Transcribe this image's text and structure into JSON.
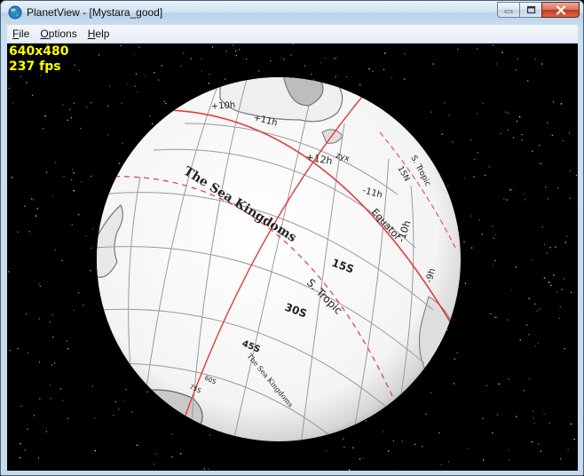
{
  "window": {
    "title": "PlanetView - [Mystara_good]",
    "app_icon": "globe-icon"
  },
  "menu": {
    "items": [
      {
        "label": "File",
        "accesskey": "F"
      },
      {
        "label": "Options",
        "accesskey": "O"
      },
      {
        "label": "Help",
        "accesskey": "H"
      }
    ]
  },
  "hud": {
    "resolution": "640x480",
    "fps": "237 fps"
  },
  "globe": {
    "hour_labels": [
      "+10h",
      "+11h",
      "+12h",
      "-11h",
      "-10h",
      "-9h"
    ],
    "equator_label": "Equator",
    "north_labels": [
      "15N",
      "S. Tropic"
    ],
    "lat_labels": [
      "15S",
      "S. Tropic",
      "30S",
      "45S"
    ],
    "region_labels": [
      "The Sea Kingdoms",
      "The Sea Kingdoms"
    ],
    "small_labels": [
      "60S",
      "75S",
      "zyx"
    ]
  },
  "colors": {
    "hud_text": "#ffff00",
    "grid_red": "#e23a3a",
    "grid_gray": "#9a9a9a"
  }
}
